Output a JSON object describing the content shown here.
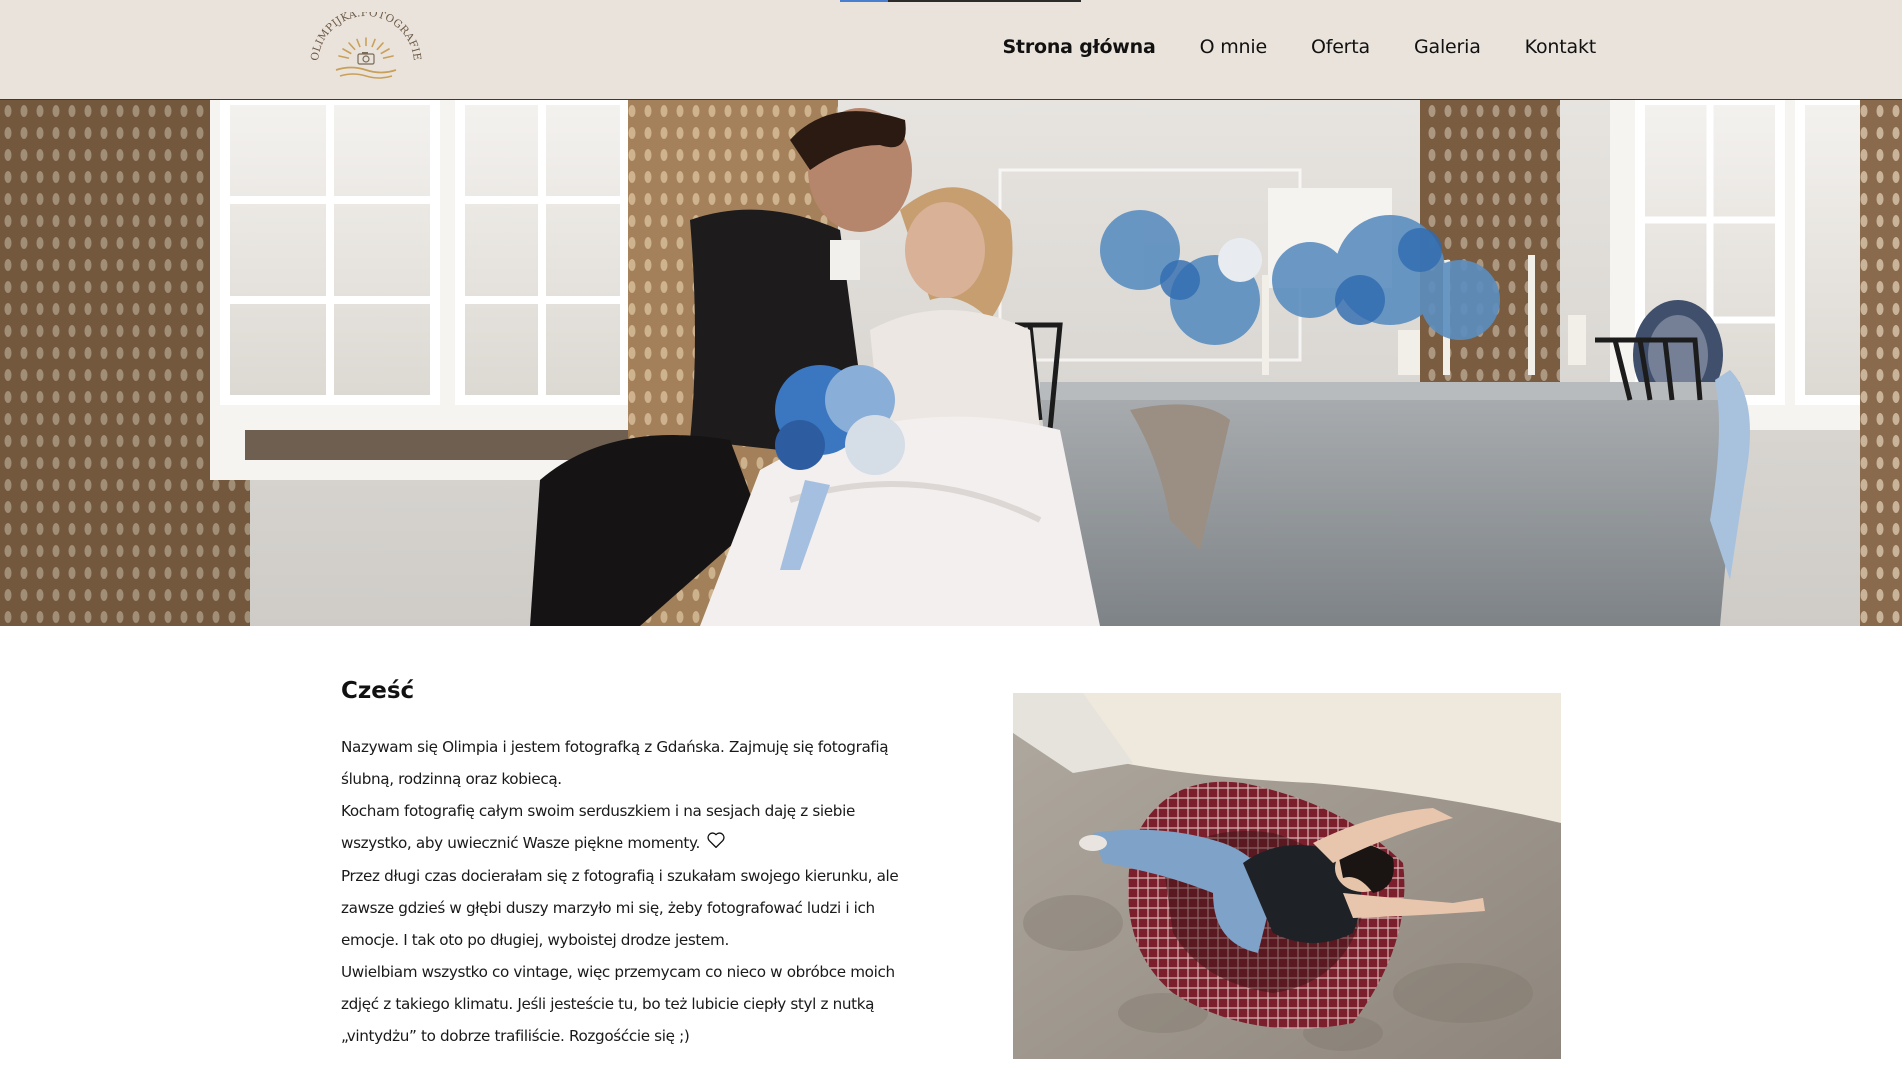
{
  "header": {
    "logo_text": "OLIMPIJKA.FOTOGRAFIE",
    "progress_fraction": 0.2,
    "nav": [
      {
        "label": "Strona główna",
        "active": true
      },
      {
        "label": "O mnie",
        "active": false
      },
      {
        "label": "Oferta",
        "active": false
      },
      {
        "label": "Galeria",
        "active": false
      },
      {
        "label": "Kontakt",
        "active": false
      }
    ]
  },
  "hero": {
    "icon": "wedding-photo"
  },
  "about": {
    "title": "Cześć",
    "paragraphs": [
      "Nazywam się Olimpia i jestem fotografką z Gdańska. Zajmuję się fotografią ślubną, rodzinną oraz kobiecą.",
      "Kocham fotografię całym swoim serduszkiem i na sesjach daję z siebie wszystko, aby uwiecznić Wasze piękne momenty.",
      "Przez długi czas docierałam się z fotografią i szukałam swojego kierunku, ale zawsze gdzieś w głębi duszy marzyło mi się, żeby fotografować ludzi i ich emocje. I tak oto po długiej, wyboistej drodze jestem.",
      "Uwielbiam wszystko co vintage, więc przemycam co nieco w obróbce moich zdjęć z takiego klimatu. Jeśli jesteście tu, bo też lubicie ciepły styl z nutką „vintydżu” to dobrze trafiliście. Rozgośćcie się ;)"
    ]
  },
  "colors": {
    "header_bg": "#eae3db",
    "progress_accent": "#4a7fd0",
    "logo_gold": "#c9a05a"
  }
}
